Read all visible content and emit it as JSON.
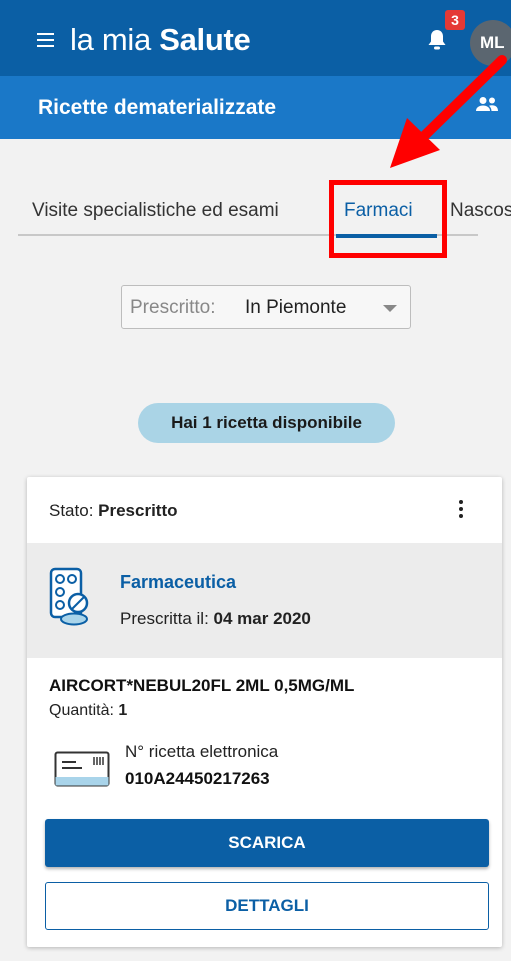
{
  "app": {
    "brand_light": "la mia ",
    "brand_bold": "Salute",
    "notification_count": "3",
    "avatar_initials": "ML",
    "menu_icon": "hamburger-menu-icon",
    "bell_icon": "bell-icon",
    "group_icon": "people-icon"
  },
  "subheader": {
    "title": "Ricette dematerializzate"
  },
  "tabs": [
    {
      "label": "Visite specialistiche ed esami",
      "active": false
    },
    {
      "label": "Farmaci",
      "active": true
    },
    {
      "label": "Nascoste",
      "active": false
    }
  ],
  "filter": {
    "label": "Prescritto:",
    "value": "In Piemonte"
  },
  "summary": {
    "text": "Hai 1 ricetta disponibile"
  },
  "card": {
    "state_label": "Stato: ",
    "state_value": "Prescritto",
    "category": "Farmaceutica",
    "prescribed_label": "Prescritta il: ",
    "prescribed_date": "04 mar 2020",
    "drug_name": "AIRCORT*NEBUL20FL 2ML 0,5MG/ML",
    "quantity_label": "Quantità: ",
    "quantity_value": "1",
    "rx_label": "N° ricetta elettronica",
    "rx_number": "010A24450217263",
    "download_label": "SCARICA",
    "details_label": "DETTAGLI"
  },
  "colors": {
    "header": "#0b5fa5",
    "subheader": "#1a78c8",
    "accent": "#0b5fa5",
    "badge": "#e53935",
    "pill": "#aad4e6",
    "annotation": "#ff0000"
  }
}
